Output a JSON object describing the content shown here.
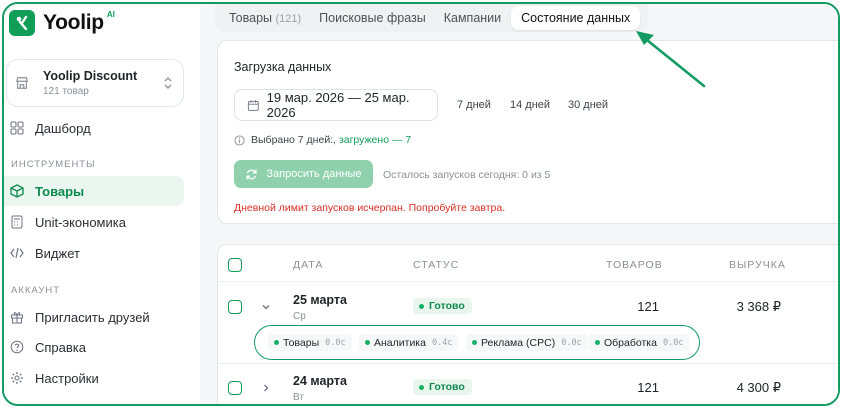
{
  "brand": {
    "name": "Yoolip",
    "badge": "AI",
    "color": "#0f9d58"
  },
  "shop": {
    "name": "Yoolip Discount",
    "sub": "121 товар"
  },
  "nav": {
    "dashboard": "Дашборд",
    "tools_label": "ИНСТРУМЕНТЫ",
    "products": "Товары",
    "unit": "Unit-экономика",
    "widget": "Виджет",
    "account_label": "АККАУНТ",
    "invite": "Пригласить друзей",
    "help": "Справка",
    "settings": "Настройки"
  },
  "tabs": {
    "products": "Товары",
    "products_count": "(121)",
    "phrases": "Поисковые фразы",
    "campaigns": "Кампании",
    "data_state": "Состояние данных"
  },
  "load": {
    "title": "Загрузка данных",
    "date_range": "19 мар. 2026 — 25 мар. 2026",
    "presets": [
      "7 дней",
      "14 дней",
      "30 дней"
    ],
    "selected_text": "Выбрано 7 дней:,",
    "loaded_text": "загружено — 7",
    "request_button": "Запросить данные",
    "remaining": "Осталось запусков сегодня: 0 из 5",
    "error": "Дневной лимит запусков исчерпан. Попробуйте завтра."
  },
  "table": {
    "headers": {
      "date": "ДАТА",
      "status": "СТАТУС",
      "products": "ТОВАРОВ",
      "revenue": "ВЫРУЧКА"
    },
    "rows": [
      {
        "date": "25 марта",
        "weekday": "Ср",
        "status": "Готово",
        "products": "121",
        "revenue": "3 368 ₽"
      },
      {
        "date": "24 марта",
        "weekday": "Вт",
        "status": "Готово",
        "products": "121",
        "revenue": "4 300 ₽"
      }
    ],
    "stages": [
      {
        "name": "Товары",
        "time": "0.0с"
      },
      {
        "name": "Аналитика",
        "time": "0.4с"
      },
      {
        "name": "Реклама (CPC)",
        "time": "0.0с"
      },
      {
        "name": "Обработка",
        "time": "0.0с"
      }
    ]
  },
  "colors": {
    "accent": "#0f9d58",
    "highlight": "#139c62",
    "error": "#d93025"
  }
}
